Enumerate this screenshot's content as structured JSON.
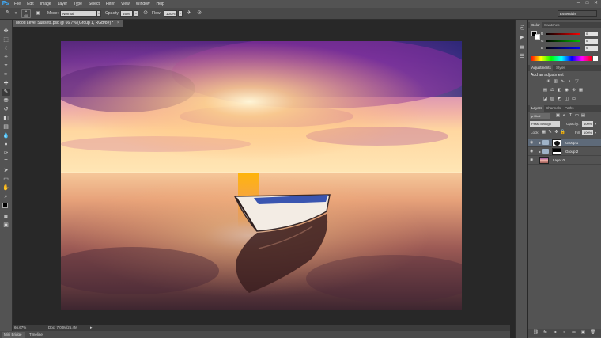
{
  "app": {
    "logo": "Ps"
  },
  "menu": [
    "File",
    "Edit",
    "Image",
    "Layer",
    "Type",
    "Select",
    "Filter",
    "View",
    "Window",
    "Help"
  ],
  "window_controls": [
    "–",
    "□",
    "✕"
  ],
  "options_bar": {
    "brush_size": "400",
    "mode_label": "Mode:",
    "mode_value": "Normal",
    "opacity_label": "Opacity:",
    "opacity_value": "46%",
    "flow_label": "Flow:",
    "flow_value": "100%",
    "workspace": "Essentials"
  },
  "document": {
    "tab_title": "Mood Level Sunsets.psd @ 66.7% (Group 1, RGB/8#) *",
    "close": "×",
    "zoom": "66.67%",
    "doc_info": "Doc: 7.00M/25.4M"
  },
  "bottom_tabs": [
    "Mini Bridge",
    "Timeline"
  ],
  "color_panel": {
    "tabs": [
      "Color",
      "Swatches"
    ],
    "sliders": [
      {
        "label": "R",
        "value": "0",
        "color": "#ff0000"
      },
      {
        "label": "G",
        "value": "0",
        "color": "#00c000"
      },
      {
        "label": "B",
        "value": "0",
        "color": "#0000ff"
      }
    ]
  },
  "adjustments_panel": {
    "tabs": [
      "Adjustments",
      "Styles"
    ],
    "title": "Add an adjustment"
  },
  "layers_panel": {
    "tabs": [
      "Layers",
      "Channels",
      "Paths"
    ],
    "kind_label": "ρ Kind",
    "blend_mode": "Pass Through",
    "opacity_label": "Opacity:",
    "opacity_value": "100%",
    "lock_label": "Lock:",
    "fill_label": "Fill:",
    "fill_value": "100%",
    "layers": [
      {
        "name": "Group 1",
        "selected": true
      },
      {
        "name": "Group 2",
        "selected": false
      },
      {
        "name": "Layer 0",
        "selected": false
      }
    ]
  },
  "colors": {
    "chrome": "#535353",
    "workspace": "#282828",
    "accent": "#3fa9f5",
    "selected_layer": "#5e6a79"
  }
}
